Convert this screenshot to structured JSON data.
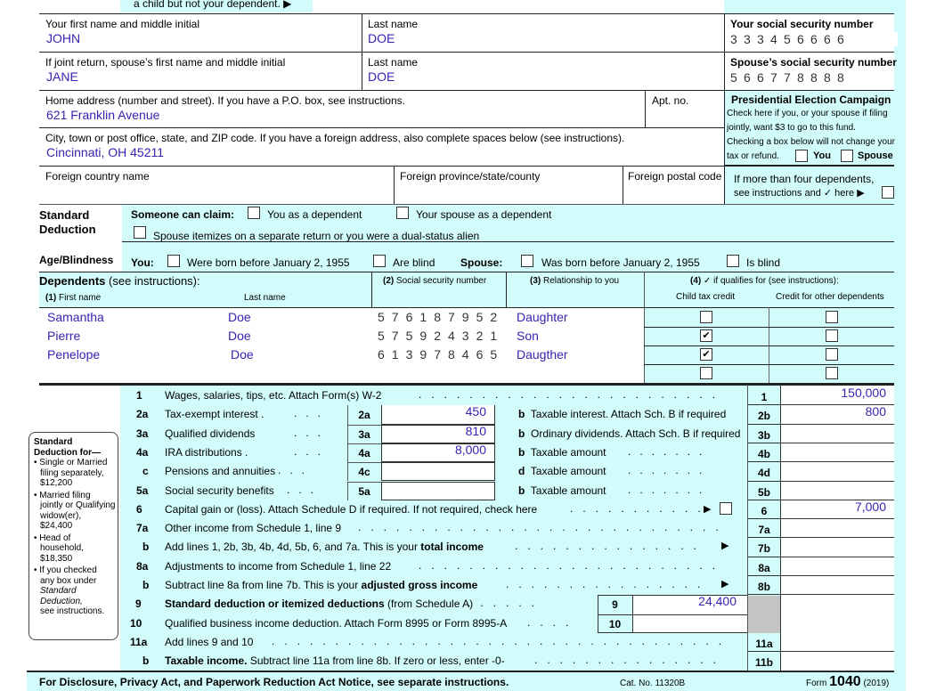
{
  "top_note": "a child but not your dependent. ▶",
  "header": {
    "first_name_label": "Your first name and middle initial",
    "first_name_value": "JOHN",
    "last_name_label": "Last name",
    "last_name_value": "DOE",
    "ssn_label": "Your social security number",
    "ssn_digits": [
      "3",
      "3",
      "3",
      "4",
      "5",
      "6",
      "6",
      "6",
      "6"
    ],
    "spouse_first_label": "If joint return, spouse’s first name and middle initial",
    "spouse_first_value": "JANE",
    "spouse_last_label": "Last name",
    "spouse_last_value": "DOE",
    "spouse_ssn_label": "Spouse’s social security number",
    "spouse_ssn_digits": [
      "5",
      "6",
      "6",
      "7",
      "7",
      "8",
      "8",
      "8",
      "8"
    ]
  },
  "address": {
    "home_label": "Home address (number and street). If you have a P.O. box, see instructions.",
    "home_value": "621 Franklin Avenue",
    "apt_label": "Apt. no.",
    "city_label": "City, town or post office, state, and ZIP code. If you have a foreign address, also complete spaces below (see instructions).",
    "city_value": "Cincinnati, OH 45211",
    "foreign_country_label": "Foreign country name",
    "foreign_province_label": "Foreign province/state/county",
    "foreign_postal_label": "Foreign postal code"
  },
  "campaign": {
    "title": "Presidential Election Campaign",
    "line1": "Check here if you, or your spouse if filing",
    "line2": "jointly, want $3 to go to this fund.",
    "line3": "Checking a box below will not change your",
    "line4": "tax or refund.",
    "you_label": "You",
    "spouse_label": "Spouse",
    "more_deps_line1": "If more than four dependents,",
    "more_deps_line2": "see instructions and ✓ here ▶"
  },
  "standard_deduction": {
    "title1": "Standard",
    "title2": "Deduction",
    "someone_label": "Someone can claim:",
    "you_dependent": "You as a dependent",
    "spouse_dependent": "Your spouse as a dependent",
    "spouse_itemizes": "Spouse itemizes on a separate return or you were a dual-status alien"
  },
  "age_blindness": {
    "title": "Age/Blindness",
    "you_label": "You:",
    "you_born": "Were born before January 2, 1955",
    "you_blind": "Are blind",
    "spouse_label": "Spouse:",
    "spouse_born": "Was born before January 2, 1955",
    "spouse_blind": "Is blind"
  },
  "dependents": {
    "title": "Dependents",
    "title_suffix": " (see instructions):",
    "col1_num": "(1)",
    "col1": "First name",
    "col1b": "Last name",
    "col2_num": "(2)",
    "col2": "Social security number",
    "col3_num": "(3)",
    "col3": "Relationship to you",
    "col4_num": "(4)",
    "col4": "✓ if qualifies for (see instructions):",
    "col4a": "Child tax credit",
    "col4b": "Credit for other dependents",
    "rows": [
      {
        "first": "Samantha",
        "last": "Doe",
        "ssn": [
          "5",
          "7",
          "6",
          "1",
          "8",
          "7",
          "9",
          "5",
          "2"
        ],
        "relationship": "Daughter",
        "child_credit": "",
        "other_credit": ""
      },
      {
        "first": "Pierre",
        "last": "Doe",
        "ssn": [
          "5",
          "7",
          "5",
          "9",
          "2",
          "4",
          "3",
          "2",
          "1"
        ],
        "relationship": "Son",
        "child_credit": "✔",
        "other_credit": ""
      },
      {
        "first": "Penelope",
        "last": "Doe",
        "ssn": [
          "6",
          "1",
          "3",
          "9",
          "7",
          "8",
          "4",
          "6",
          "5"
        ],
        "relationship": "Daugther",
        "child_credit": "✔",
        "other_credit": ""
      },
      {
        "first": "",
        "last": "",
        "ssn": [
          "",
          "",
          "",
          "",
          "",
          "",
          "",
          "",
          ""
        ],
        "relationship": "",
        "child_credit": "",
        "other_credit": ""
      }
    ]
  },
  "sidebar_note": {
    "title1": "Standard",
    "title2": "Deduction for—",
    "b1": [
      "• Single or Married",
      "filing separately,",
      "$12,200"
    ],
    "b2": [
      "• Married filing",
      "jointly or Qualifying",
      "widow(er),",
      "$24,400"
    ],
    "b3": [
      "• Head of",
      "household,",
      "$18,350"
    ],
    "b4a": "• If you checked",
    "b4b": "any box under",
    "b4c": "Standard",
    "b4d": "Deduction,",
    "b4e": "see instructions."
  },
  "income": {
    "l1": {
      "num": "1",
      "text": "Wages, salaries, tips, etc. Attach Form(s) W-2",
      "box": "1",
      "amount": "150,000"
    },
    "l2a": {
      "num": "2a",
      "text": "Tax-exempt interest .",
      "box": "2a",
      "amount": "450"
    },
    "l2b": {
      "num": "b",
      "text": "Taxable interest. Attach Sch. B if required",
      "box": "2b",
      "amount": "800"
    },
    "l3a": {
      "num": "3a",
      "text": "Qualified dividends",
      "box": "3a",
      "amount": "810"
    },
    "l3b": {
      "num": "b",
      "text": "Ordinary dividends. Attach Sch. B if required",
      "box": "3b",
      "amount": ""
    },
    "l4a": {
      "num": "4a",
      "text": "IRA distributions .",
      "box": "4a",
      "amount": "8,000"
    },
    "l4b": {
      "num": "b",
      "text": "Taxable amount",
      "box": "4b",
      "amount": ""
    },
    "l4c": {
      "num": "c",
      "text": "Pensions and annuities",
      "box": "4c",
      "amount": ""
    },
    "l4d": {
      "num": "d",
      "text": "Taxable amount",
      "box": "4d",
      "amount": ""
    },
    "l5a": {
      "num": "5a",
      "text": "Social security benefits",
      "box": "5a",
      "amount": ""
    },
    "l5b": {
      "num": "b",
      "text": "Taxable amount",
      "box": "5b",
      "amount": ""
    },
    "l6": {
      "num": "6",
      "text": "Capital gain or (loss). Attach Schedule D if required. If not required, check here",
      "box": "6",
      "amount": "7,000"
    },
    "l7a": {
      "num": "7a",
      "text": "Other income from Schedule 1, line 9",
      "box": "7a",
      "amount": ""
    },
    "l7b": {
      "num": "b",
      "text_pre": "Add lines 1, 2b, 3b, 4b, 4d, 5b, 6, and 7a. This is your ",
      "text_bold": "total income",
      "box": "7b",
      "amount": ""
    },
    "l8a": {
      "num": "8a",
      "text": "Adjustments to income from Schedule 1, line 22",
      "box": "8a",
      "amount": ""
    },
    "l8b": {
      "num": "b",
      "text_pre": "Subtract line 8a from line 7b. This is your ",
      "text_bold": "adjusted gross income",
      "box": "8b",
      "amount": ""
    },
    "l9": {
      "num": "9",
      "text_bold": "Standard deduction or itemized deductions",
      "text_post": " (from Schedule A)",
      "box": "9",
      "amount": "24,400"
    },
    "l10": {
      "num": "10",
      "text": "Qualified business income deduction. Attach Form 8995 or Form 8995-A",
      "box": "10",
      "amount": ""
    },
    "l11a": {
      "num": "11a",
      "text": "Add lines 9 and 10",
      "box": "11a",
      "amount": ""
    },
    "l11b": {
      "num": "b",
      "text_bold": "Taxable income.",
      "text_post": " Subtract line 11a from line 8b. If zero or less, enter -0-",
      "box": "11b",
      "amount": ""
    }
  },
  "footer": {
    "notice": "For Disclosure, Privacy Act, and Paperwork Reduction Act Notice, see separate instructions.",
    "cat_no": "Cat. No. 11320B",
    "form_prefix": "Form ",
    "form_num": "1040",
    "form_year": " (2019)"
  }
}
